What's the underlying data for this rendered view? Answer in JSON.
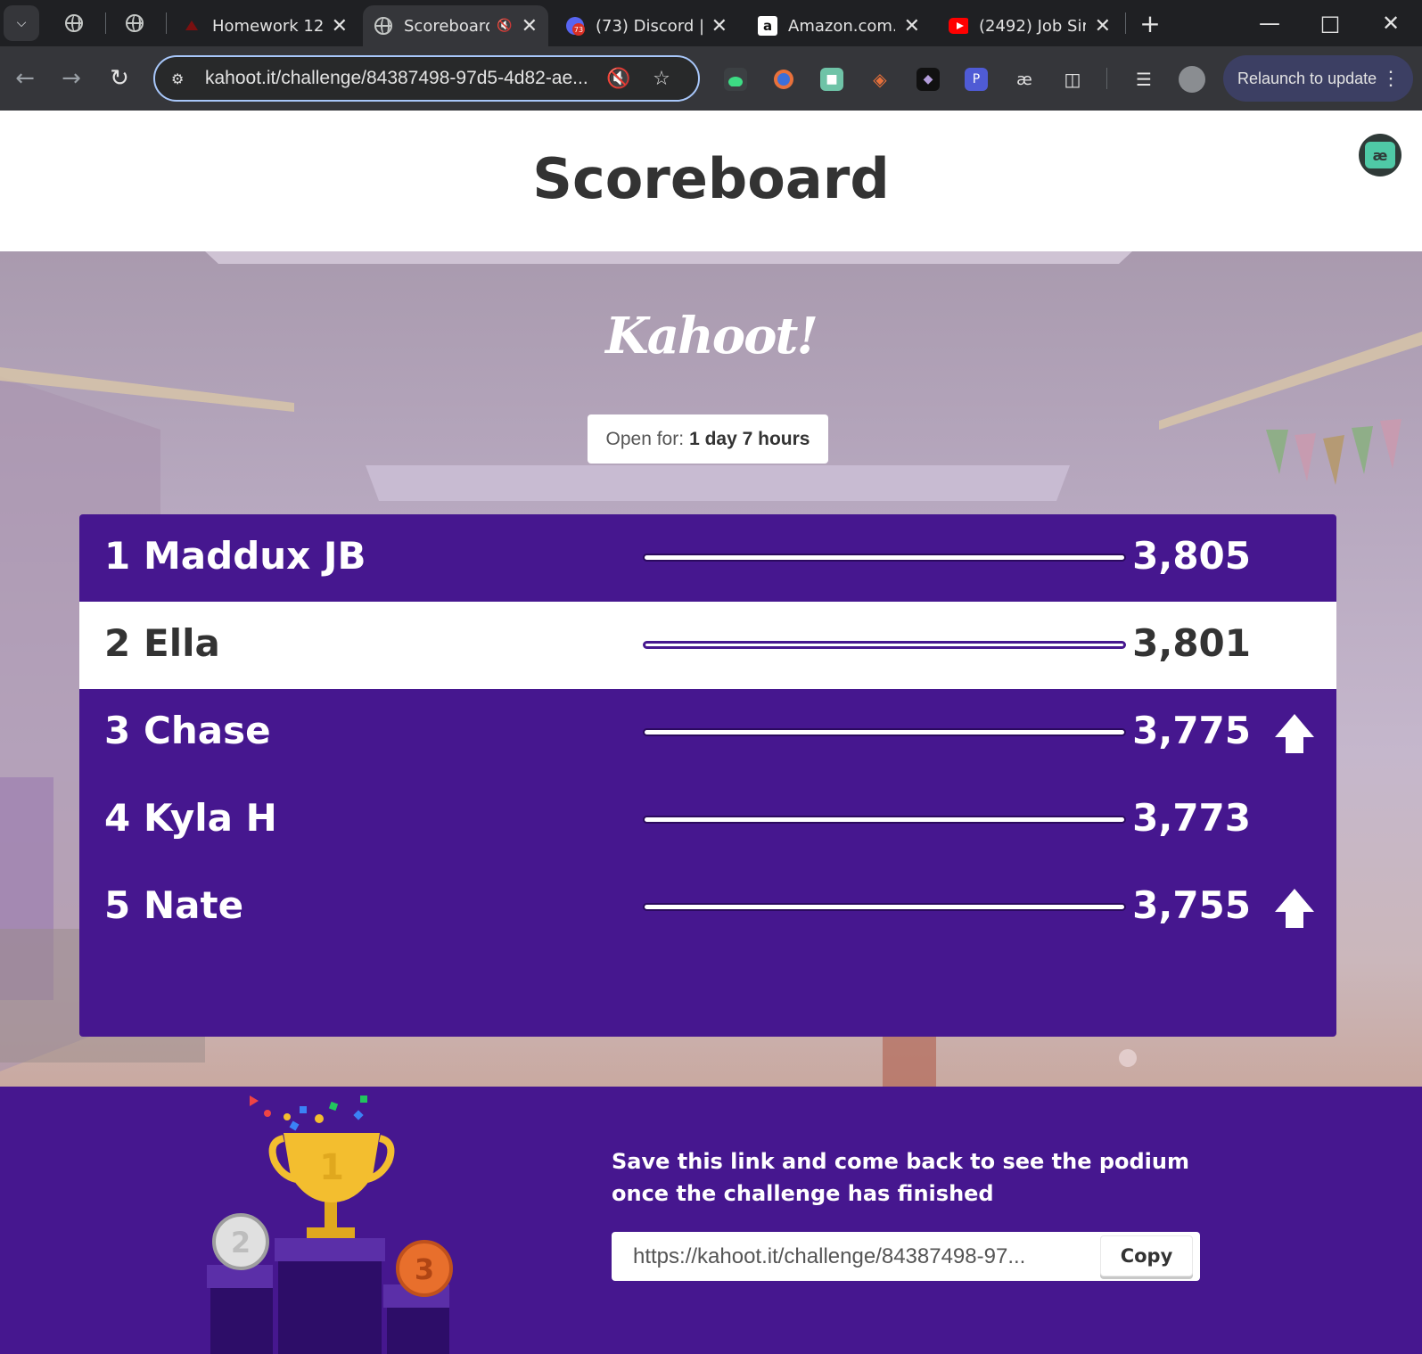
{
  "browser": {
    "tabs": [
      {
        "title": "Homework 12",
        "favicon": "red-logo-icon",
        "active": false
      },
      {
        "title": "Scoreboard",
        "favicon": "globe-icon",
        "active": true,
        "muted": true
      },
      {
        "title": "(73) Discord |",
        "favicon": "discord-icon",
        "badge": "73",
        "active": false
      },
      {
        "title": "Amazon.com.",
        "favicon": "amazon-icon",
        "active": false
      },
      {
        "title": "(2492) Job Sir",
        "favicon": "youtube-icon",
        "active": false
      }
    ],
    "url": "kahoot.it/challenge/84387498-97d5-4d82-ae...",
    "relaunch_label": "Relaunch to update",
    "accent": "#a8c7fa"
  },
  "page": {
    "title": "Scoreboard",
    "logo_text": "Kahoot!",
    "open_for_label": "Open for:",
    "open_for_value": "1 day 7 hours"
  },
  "scoreboard": {
    "rows": [
      {
        "rank": "1",
        "name": "Maddux JB",
        "score": "3,805",
        "trend_up": false,
        "highlight": false
      },
      {
        "rank": "2",
        "name": "Ella",
        "score": "3,801",
        "trend_up": false,
        "highlight": true
      },
      {
        "rank": "3",
        "name": "Chase",
        "score": "3,775",
        "trend_up": true,
        "highlight": false
      },
      {
        "rank": "4",
        "name": "Kyla H",
        "score": "3,773",
        "trend_up": false,
        "highlight": false
      },
      {
        "rank": "5",
        "name": "Nate",
        "score": "3,755",
        "trend_up": true,
        "highlight": false
      }
    ],
    "color": "#46178f"
  },
  "footer": {
    "message": "Save this link and come back to see the podium once the challenge has finished",
    "link": "https://kahoot.it/challenge/84387498-97...",
    "copy_label": "Copy",
    "podium_labels": [
      "2",
      "1",
      "3"
    ]
  }
}
